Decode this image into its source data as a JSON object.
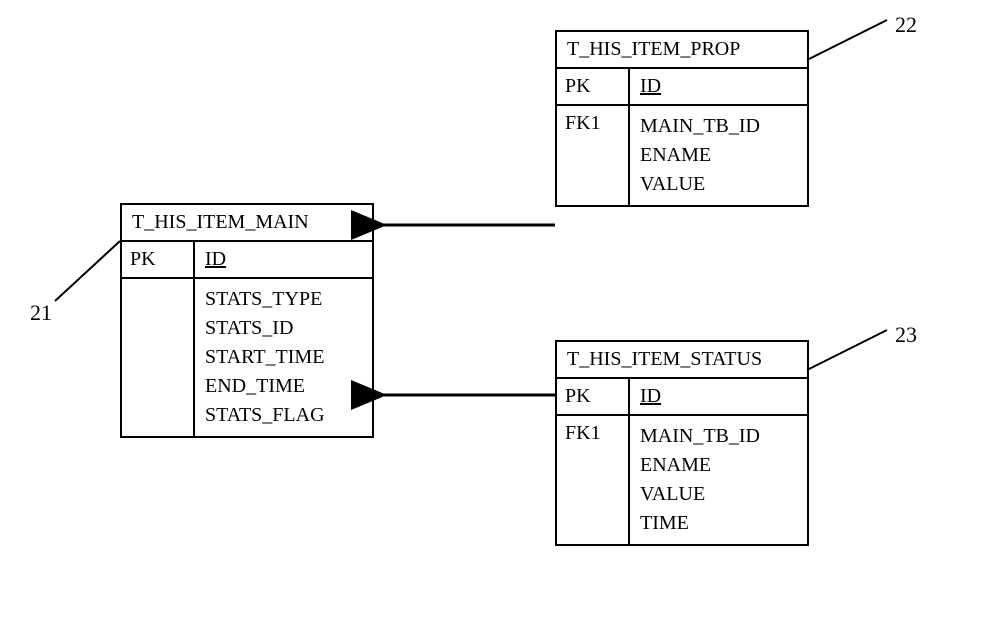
{
  "entities": {
    "main": {
      "title": "T_HIS_ITEM_MAIN",
      "pk_label": "PK",
      "pk_field": "ID",
      "fields": [
        "STATS_TYPE",
        "STATS_ID",
        "START_TIME",
        "END_TIME",
        "STATS_FLAG"
      ],
      "callout": "21"
    },
    "prop": {
      "title": "T_HIS_ITEM_PROP",
      "pk_label": "PK",
      "pk_field": "ID",
      "fk1_label": "FK1",
      "fields": [
        "MAIN_TB_ID",
        "ENAME",
        "VALUE"
      ],
      "callout": "22"
    },
    "status": {
      "title": "T_HIS_ITEM_STATUS",
      "pk_label": "PK",
      "pk_field": "ID",
      "fk1_label": "FK1",
      "fields": [
        "MAIN_TB_ID",
        "ENAME",
        "VALUE",
        "TIME"
      ],
      "callout": "23"
    }
  }
}
